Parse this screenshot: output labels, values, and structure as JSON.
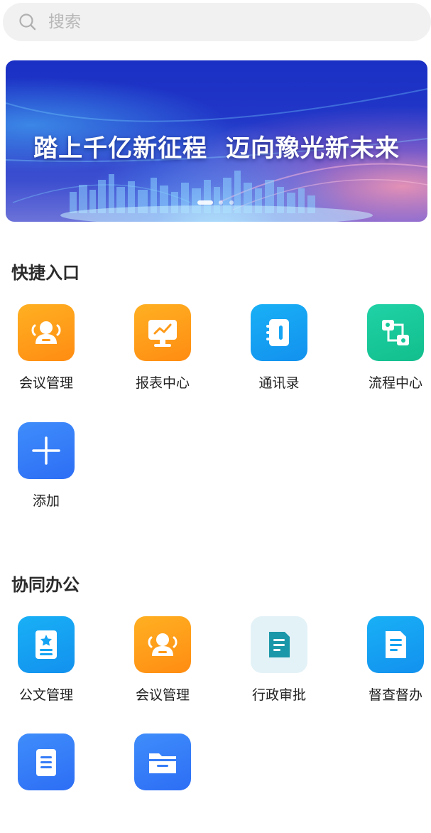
{
  "search": {
    "placeholder": "搜索"
  },
  "banner": {
    "slogan": "踏上千亿新征程  迈向豫光新未来"
  },
  "quick_entry": {
    "title": "快捷入口",
    "items": [
      {
        "label": "会议管理",
        "icon": "meeting-people-icon",
        "color": "#ff9a18"
      },
      {
        "label": "报表中心",
        "icon": "report-chart-icon",
        "color": "#ff9a18"
      },
      {
        "label": "通讯录",
        "icon": "contacts-book-icon",
        "color": "#15a4f3"
      },
      {
        "label": "流程中心",
        "icon": "workflow-icon",
        "color": "#18c89a"
      },
      {
        "label": "添加",
        "icon": "plus-icon",
        "color": "#357cf7"
      }
    ]
  },
  "collaboration": {
    "title": "协同办公",
    "items": [
      {
        "label": "公文管理",
        "icon": "document-badge-icon",
        "color": "#15a4f3"
      },
      {
        "label": "会议管理",
        "icon": "meeting-people-icon",
        "color": "#ff9a18"
      },
      {
        "label": "行政审批",
        "icon": "approval-doc-icon",
        "color": "#1a97a8"
      },
      {
        "label": "督查督办",
        "icon": "supervision-doc-icon",
        "color": "#15a4f3"
      },
      {
        "label": "",
        "icon": "document-list-icon",
        "color": "#357cf7"
      },
      {
        "label": "",
        "icon": "folder-icon",
        "color": "#357cf7"
      }
    ]
  }
}
